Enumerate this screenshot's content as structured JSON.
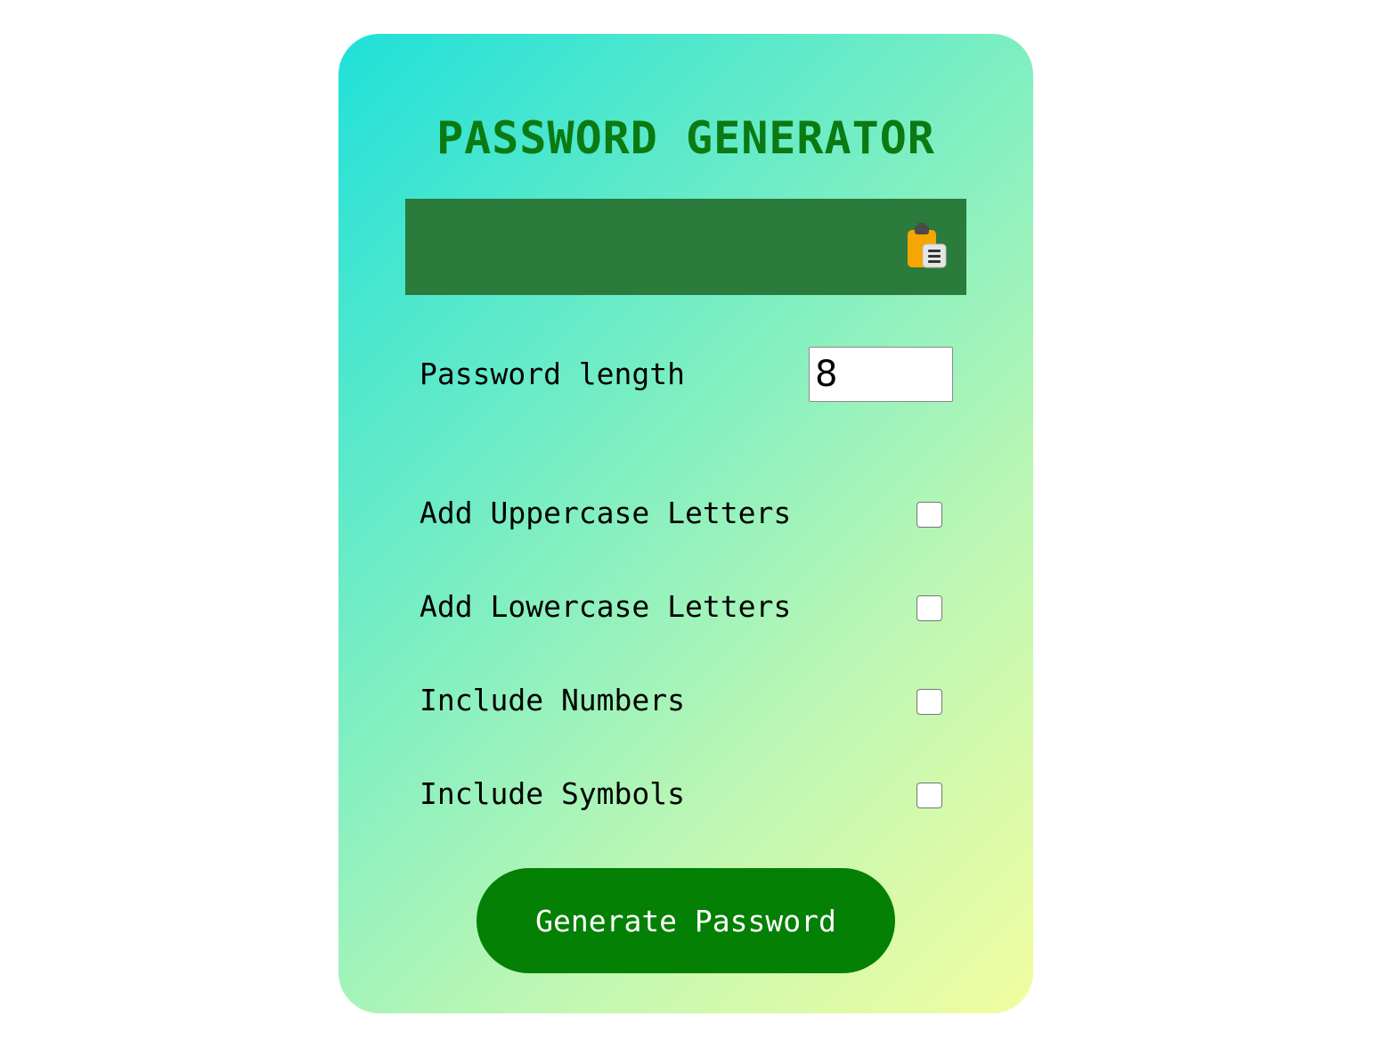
{
  "app": {
    "title": "PASSWORD GENERATOR"
  },
  "output": {
    "value": "",
    "copy_icon": "clipboard-icon"
  },
  "length": {
    "label": "Password length",
    "value": "8"
  },
  "options": [
    {
      "label": "Add Uppercase Letters",
      "checked": false
    },
    {
      "label": "Add Lowercase Letters",
      "checked": false
    },
    {
      "label": "Include Numbers",
      "checked": false
    },
    {
      "label": "Include Symbols",
      "checked": false
    }
  ],
  "actions": {
    "generate_label": "Generate Password"
  },
  "colors": {
    "title": "#0c7a12",
    "output_bg": "#2a7b3c",
    "button_bg": "#048005",
    "gradient_start": "#1fe0d9",
    "gradient_end": "#f2fda0"
  }
}
